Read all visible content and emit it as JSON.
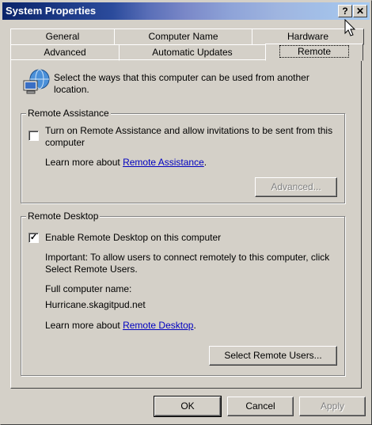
{
  "window": {
    "title": "System Properties",
    "help_label": "?",
    "close_label": "✕"
  },
  "tabs_row1": [
    {
      "label": "General"
    },
    {
      "label": "Computer Name"
    },
    {
      "label": "Hardware"
    }
  ],
  "tabs_row2": [
    {
      "label": "Advanced"
    },
    {
      "label": "Automatic Updates"
    },
    {
      "label": "Remote"
    }
  ],
  "intro": {
    "text": "Select the ways that this computer can be used from another location.",
    "icon": "computer-network-icon"
  },
  "remote_assistance": {
    "title": "Remote Assistance",
    "checkbox_label": "Turn on Remote Assistance and allow invitations to be sent from this computer",
    "checked": false,
    "learn_more_prefix": "Learn more about ",
    "learn_more_link": "Remote Assistance",
    "learn_more_suffix": ".",
    "advanced_button": "Advanced..."
  },
  "remote_desktop": {
    "title": "Remote Desktop",
    "checkbox_label": "Enable Remote Desktop on this computer",
    "checked": true,
    "important": "Important: To allow users to connect remotely to this computer, click Select Remote Users.",
    "full_name_label": "Full computer name:",
    "full_name_value": "Hurricane.skagitpud.net",
    "learn_more_prefix": "Learn more about ",
    "learn_more_link": "Remote Desktop",
    "learn_more_suffix": ".",
    "select_users_button": "Select Remote Users..."
  },
  "footer": {
    "ok": "OK",
    "cancel": "Cancel",
    "apply": "Apply"
  }
}
